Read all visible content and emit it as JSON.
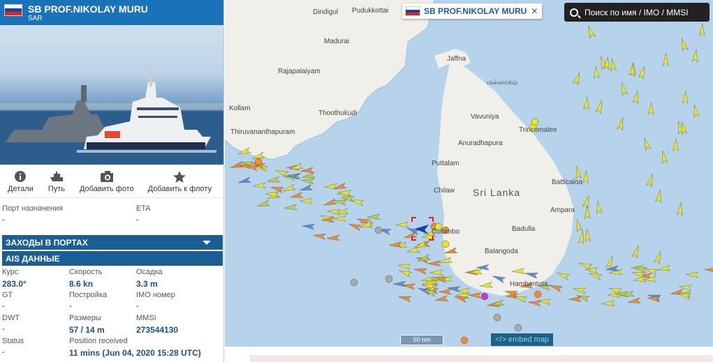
{
  "panel": {
    "vessel_name": "SB PROF.NIKOLAY MURU",
    "vessel_type": "SAR",
    "photo_alt": "vessel photo",
    "actions": [
      {
        "label": "Детали",
        "icon": "info-icon"
      },
      {
        "label": "Путь",
        "icon": "ship-path-icon"
      },
      {
        "label": "Добавить фото",
        "icon": "camera-icon"
      },
      {
        "label": "Добавить к флоту",
        "icon": "star-icon"
      }
    ],
    "destination": {
      "label": "Порт назначения",
      "value": "-"
    },
    "eta": {
      "label": "ETA",
      "value": "-"
    },
    "port_calls_title": "ЗАХОДЫ В ПОРТАХ",
    "ais_title": "AIS ДАННЫЕ",
    "ais": {
      "course": {
        "label": "Курс",
        "value": "283.0°"
      },
      "speed": {
        "label": "Скорость",
        "value": "8.6 kn"
      },
      "draught": {
        "label": "Осадка",
        "value": "3.3 m"
      },
      "gt": {
        "label": "GT",
        "value": "-"
      },
      "built": {
        "label": "Постройка",
        "value": "-"
      },
      "imo": {
        "label": "IMO номер",
        "value": "-"
      },
      "dwt": {
        "label": "DWT",
        "value": "-"
      },
      "size": {
        "label": "Размеры",
        "value": "57 / 14 m"
      },
      "mmsi": {
        "label": "MMSI",
        "value": "273544130"
      },
      "status": {
        "label": "Status",
        "value": "-"
      },
      "position_received": {
        "label": "Position received",
        "value": "11 mins (Jun 04, 2020 15:28 UTC)"
      }
    }
  },
  "map": {
    "popup_name": "SB PROF.NIKOLAY MURU",
    "search_placeholder": "Поиск по имя / IMO / MMSI",
    "scale": "50 nm",
    "embed": "</> embed map",
    "places": [
      {
        "name": "Dindigul"
      },
      {
        "name": "Pudukkottai"
      },
      {
        "name": "Madurai"
      },
      {
        "name": "Rajapalaiyam"
      },
      {
        "name": "Kollam"
      },
      {
        "name": "Thoothukudi"
      },
      {
        "name": "Thiruvananthapuram"
      },
      {
        "name": "Jaffna"
      },
      {
        "name": "மல்லாகம்"
      },
      {
        "name": "Vavuniya"
      },
      {
        "name": "Anuradhapura"
      },
      {
        "name": "Puttalam"
      },
      {
        "name": "Trincomalee"
      },
      {
        "name": "Chilaw"
      },
      {
        "name": "Sri Lanka"
      },
      {
        "name": "Batticaloa"
      },
      {
        "name": "Ampara"
      },
      {
        "name": "Colombo"
      },
      {
        "name": "Badulla"
      },
      {
        "name": "Balangoda"
      },
      {
        "name": "Hambantota"
      }
    ],
    "colors": {
      "yellow": "#e8e52a",
      "orange": "#f08b2e",
      "blue": "#5b8fd6",
      "green": "#bfd23c",
      "purple": "#c83ad4",
      "sea": "#b7d3ec",
      "land": "#f1efe9"
    }
  }
}
